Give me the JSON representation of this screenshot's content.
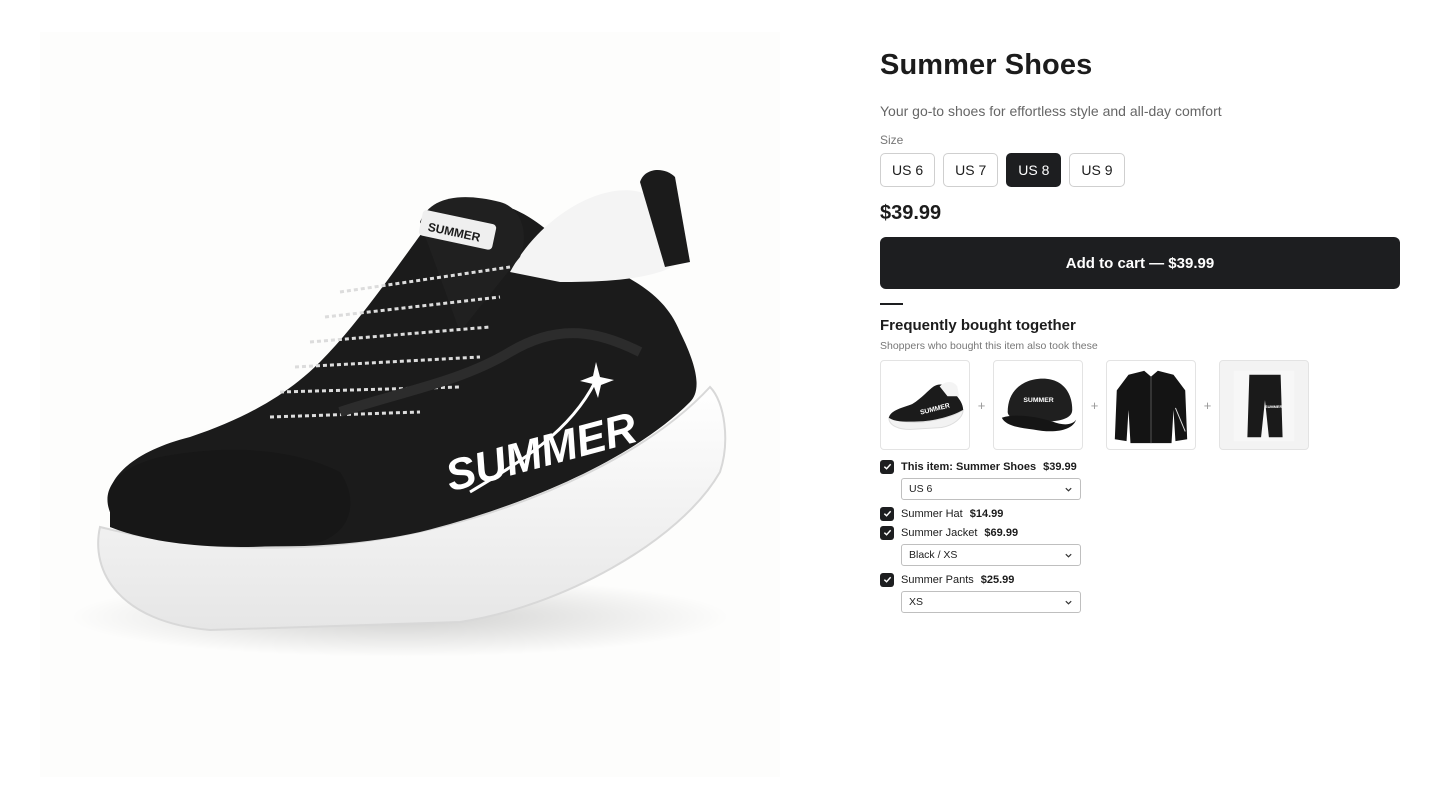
{
  "product": {
    "title": "Summer Shoes",
    "subtitle": "Your go-to shoes for effortless style and all-day comfort",
    "size_label": "Size",
    "sizes": [
      "US 6",
      "US 7",
      "US 8",
      "US 9"
    ],
    "selected_size": "US 8",
    "price": "$39.99",
    "add_to_cart": "Add to cart — $39.99",
    "hero_image_icon": "sneaker-image",
    "logo_text": "SUMMER"
  },
  "fbt": {
    "title": "Frequently bought together",
    "subtitle": "Shoppers who bought this item also took these",
    "thumbs": [
      "shoe-thumbnail",
      "hat-thumbnail",
      "jacket-thumbnail",
      "pants-thumbnail"
    ],
    "plus": "+",
    "items": [
      {
        "name": "This item: Summer Shoes",
        "price": "$39.99",
        "checked": true,
        "option": "US 6"
      },
      {
        "name": "Summer Hat",
        "price": "$14.99",
        "checked": true,
        "option": null
      },
      {
        "name": "Summer Jacket",
        "price": "$69.99",
        "checked": true,
        "option": "Black / XS"
      },
      {
        "name": "Summer Pants",
        "price": "$25.99",
        "checked": true,
        "option": "XS"
      }
    ]
  },
  "colors": {
    "primary": "#1d1e20",
    "text_muted": "#666666",
    "border": "#cfcfcf"
  }
}
